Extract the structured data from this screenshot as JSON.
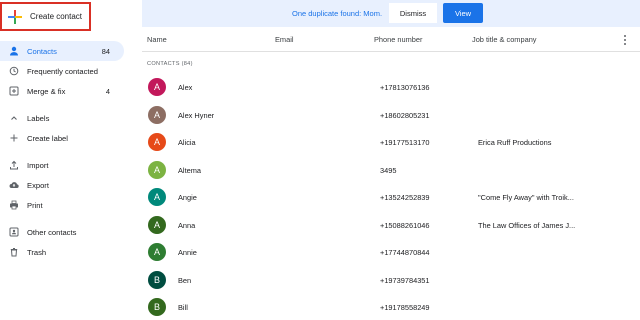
{
  "sidebar": {
    "create_label": "Create contact",
    "items": [
      {
        "label": "Contacts",
        "count": "84",
        "icon": "person-icon",
        "active": true
      },
      {
        "label": "Frequently contacted",
        "count": "",
        "icon": "history-icon",
        "active": false
      },
      {
        "label": "Merge & fix",
        "count": "4",
        "icon": "merge-icon",
        "active": false
      }
    ],
    "labels_section": [
      {
        "label": "Labels",
        "icon": "chevron-up-icon"
      },
      {
        "label": "Create label",
        "icon": "plus-icon"
      }
    ],
    "tools": [
      {
        "label": "Import",
        "icon": "import-icon"
      },
      {
        "label": "Export",
        "icon": "cloud-export-icon"
      },
      {
        "label": "Print",
        "icon": "print-icon"
      }
    ],
    "other": [
      {
        "label": "Other contacts",
        "icon": "other-contacts-icon"
      },
      {
        "label": "Trash",
        "icon": "trash-icon"
      }
    ]
  },
  "banner": {
    "text": "One duplicate found: Mom.",
    "dismiss_label": "Dismiss",
    "view_label": "View",
    "color": "#e8f0fe"
  },
  "table": {
    "headers": {
      "name": "Name",
      "email": "Email",
      "phone": "Phone number",
      "job": "Job title & company"
    },
    "section_label": "CONTACTS (84)"
  },
  "contacts": [
    {
      "initial": "A",
      "name": "Alex",
      "phone": "+17813076136",
      "job": "",
      "color": "#c2185b"
    },
    {
      "initial": "A",
      "name": "Alex Hyner",
      "phone": "+18602805231",
      "job": "",
      "color": "#8d6e63"
    },
    {
      "initial": "A",
      "name": "Alicia",
      "phone": "+19177513170",
      "job": "Erica Ruff Productions",
      "color": "#e64a19"
    },
    {
      "initial": "A",
      "name": "Altema",
      "phone": "3495",
      "job": "",
      "color": "#7cb342"
    },
    {
      "initial": "A",
      "name": "Angie",
      "phone": "+13524252839",
      "job": "\"Come Fly Away\" with Troik...",
      "color": "#00897b"
    },
    {
      "initial": "A",
      "name": "Anna",
      "phone": "+15088261046",
      "job": "The Law Offices of James J...",
      "color": "#33691e"
    },
    {
      "initial": "A",
      "name": "Annie",
      "phone": "+17744870844",
      "job": "",
      "color": "#2e7d32"
    },
    {
      "initial": "B",
      "name": "Ben",
      "phone": "+19739784351",
      "job": "",
      "color": "#004d40"
    },
    {
      "initial": "B",
      "name": "Bill",
      "phone": "+19178558249",
      "job": "",
      "color": "#33691e"
    }
  ]
}
